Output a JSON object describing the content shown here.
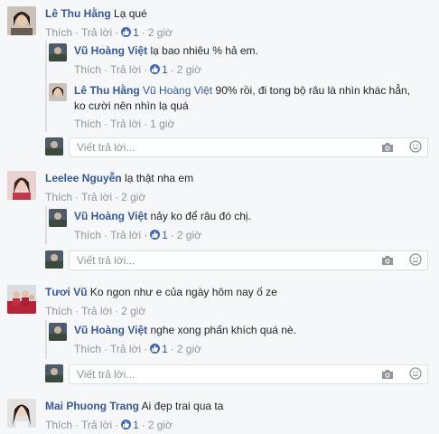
{
  "actions": {
    "like": "Thích",
    "reply": "Trả lời",
    "sep": "·"
  },
  "reply_box": {
    "placeholder": "Viết trả lời..."
  },
  "threads": [
    {
      "comment": {
        "author": "Lê Thu Hằng",
        "text": "Lạ qué",
        "likes": "1",
        "time": "2 giờ"
      },
      "replies": [
        {
          "author": "Vũ Hoàng Việt",
          "text": "lạ bao nhiêu % hả em.",
          "likes": "1",
          "time": "2 giờ"
        },
        {
          "author": "Lê Thu Hằng",
          "mention": "Vũ Hoàng Việt",
          "text_line1": "90% rồi, đi tong bộ râu là nhìn khác hẳn,",
          "text_line2": "ko cười nên nhìn lạ quá",
          "time": "1 giờ"
        }
      ]
    },
    {
      "comment": {
        "author": "Leelee Nguyễn",
        "text": "lạ thật nha em",
        "time": "2 giờ"
      },
      "replies": [
        {
          "author": "Vũ Hoàng Việt",
          "text": "nảy ko để râu đó chị.",
          "likes": "1",
          "time": "2 giờ"
        }
      ]
    },
    {
      "comment": {
        "author": "Tươi Vũ",
        "text": "Ko ngon như e của ngày hôm nay ố ze",
        "time": "2 giờ"
      },
      "replies": [
        {
          "author": "Vũ Hoàng Việt",
          "text": "nghe xong phấn khích quá nè.",
          "likes": "1",
          "time": "2 giờ"
        }
      ]
    },
    {
      "comment": {
        "author": "Mai Phuong Trang",
        "text": "Ai đẹp trai qua ta",
        "likes": "1",
        "time": "2 giờ"
      }
    }
  ],
  "colors": {
    "author": "#365899",
    "meta": "#90949c",
    "like_badge": "#4267b2",
    "background": "#f6f7f9"
  },
  "icons": [
    "like-icon",
    "camera-icon",
    "emoji-icon"
  ]
}
